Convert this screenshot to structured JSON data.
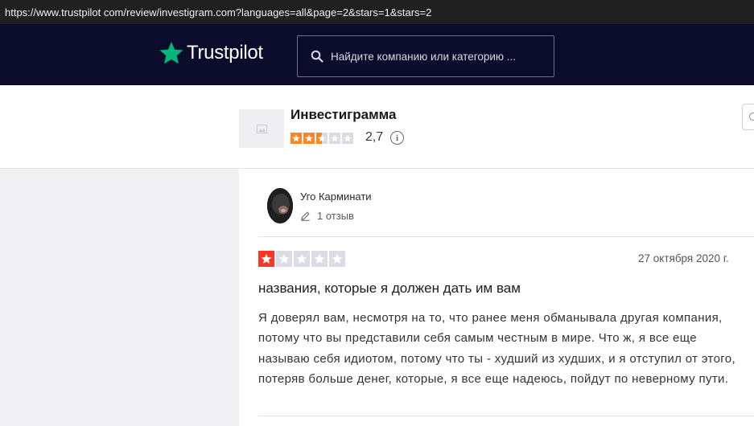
{
  "browser": {
    "url": "https://www.trustpilot com/review/investigram.com?languages=all&page=2&stars=1&stars=2"
  },
  "header": {
    "logo_text": "Trustpilot",
    "logo_icon": "star-icon",
    "brand_color": "#00b67a",
    "search_placeholder": "Найдите компанию или категорию ..."
  },
  "company": {
    "name": "Инвестиграмма",
    "logo_icon": "image-placeholder-icon",
    "score": "2,7",
    "stars_filled": 2.5,
    "stars_total": 5,
    "star_color": "#ff8622"
  },
  "review": {
    "reviewer_name": "Уго Карминати",
    "review_count": "1 отзыв",
    "rating": 1,
    "rating_color": "#ff3722",
    "date": "27 октября 2020 г.",
    "title": "названия, которые я должен дать им вам",
    "body": "Я доверял вам, несмотря на то, что ранее меня обманывала другая компания, потому что вы представили себя самым честным в мире. Что ж, я все еще называю себя идиотом, потому что ты - худший из худших, и я отступил от этого, потеряв больше денег, которые, я все еще надеюсь, пойдут по неверному пути."
  }
}
